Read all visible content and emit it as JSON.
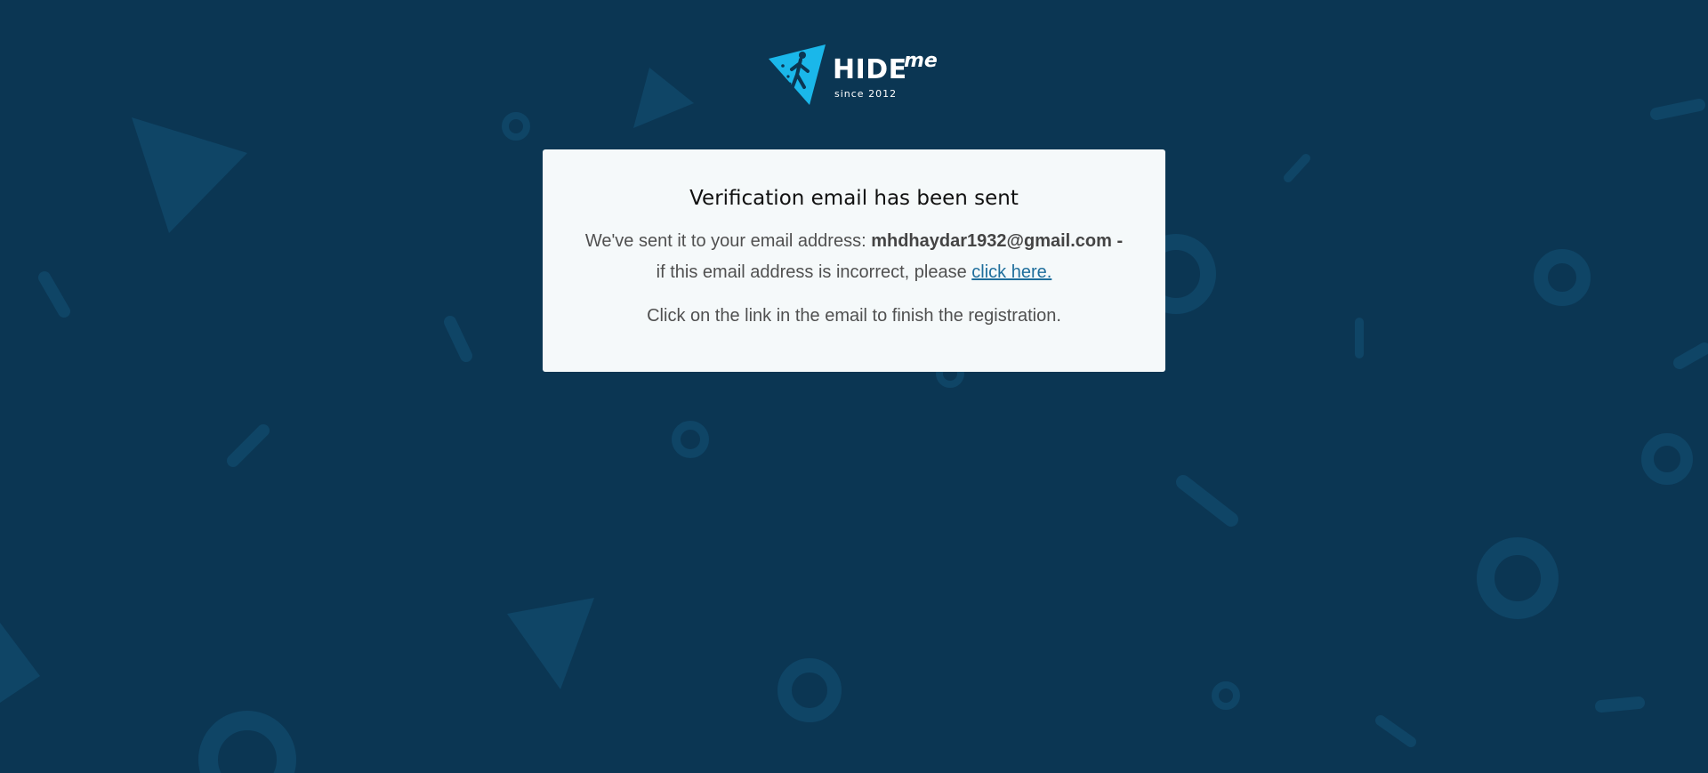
{
  "brand": {
    "name": "HIDE",
    "suffix": "me",
    "tagline": "since 2012",
    "logo_icon": "triangle-play-runner-icon",
    "accent_color": "#1ab7ea"
  },
  "background": {
    "color": "#0b3653",
    "pattern_color": "#0f4566"
  },
  "card": {
    "title": "Verification email has been sent",
    "sent_prefix": "We've sent it to your email address:",
    "email": "mhdhaydar1932@gmail.com",
    "email_suffix": "-",
    "incorrect_prefix": "if this email address is incorrect, please",
    "incorrect_link": "click here.",
    "instructions": "Click on the link in the email to finish the registration."
  }
}
